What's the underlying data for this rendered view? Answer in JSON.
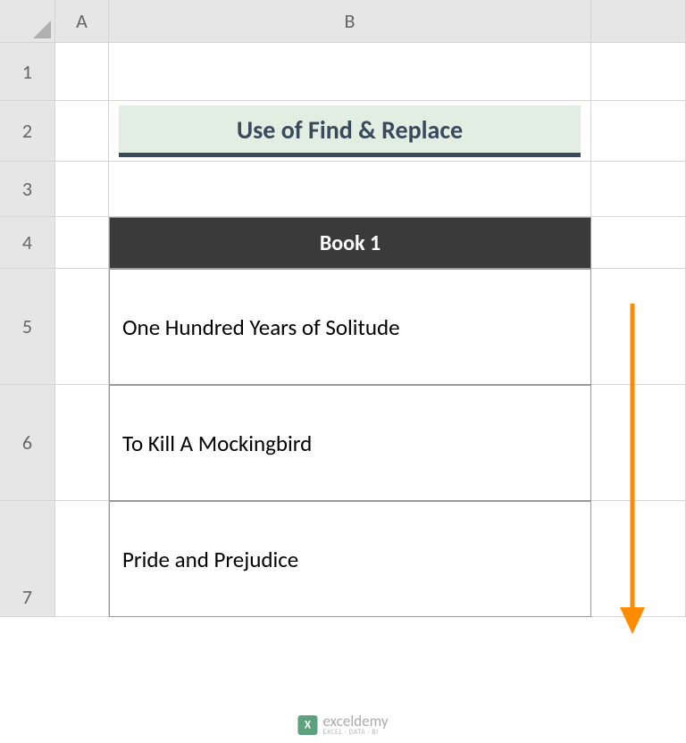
{
  "columns": {
    "a": "A",
    "b": "B"
  },
  "rows": {
    "r1": "1",
    "r2": "2",
    "r3": "3",
    "r4": "4",
    "r5": "5",
    "r6": "6",
    "r7": "7"
  },
  "title": "Use of Find & Replace",
  "table": {
    "header": "Book 1",
    "rows": [
      "One Hundred Years of Solitude",
      "To Kill A Mockingbird",
      "Pride and Prejudice"
    ]
  },
  "watermark": {
    "name": "exceldemy",
    "tagline": "EXCEL · DATA · BI"
  }
}
